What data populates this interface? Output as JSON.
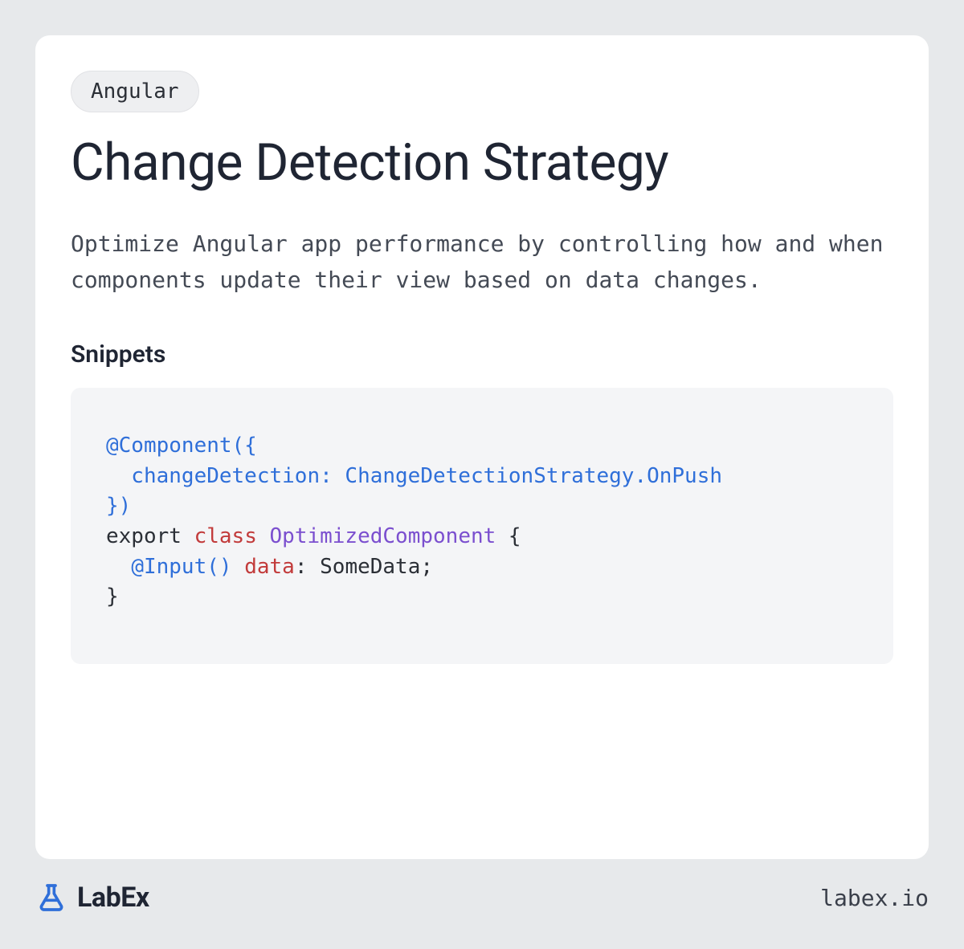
{
  "tag": "Angular",
  "title": "Change Detection Strategy",
  "description": "Optimize Angular app performance by controlling how and when components update their view based on data changes.",
  "snippets_heading": "Snippets",
  "code": {
    "l1a": "@Component({",
    "l2a": "  changeDetection: ChangeDetectionStrategy.OnPush",
    "l3a": "})",
    "l4a": "export ",
    "l4b": "class",
    "l4c": " ",
    "l4d": "OptimizedComponent",
    "l4e": " {",
    "l5a": "  ",
    "l5b": "@Input()",
    "l5c": " ",
    "l5d": "data",
    "l5e": ": SomeData;",
    "l6a": "}"
  },
  "brand_name": "LabEx",
  "brand_url": "labex.io"
}
